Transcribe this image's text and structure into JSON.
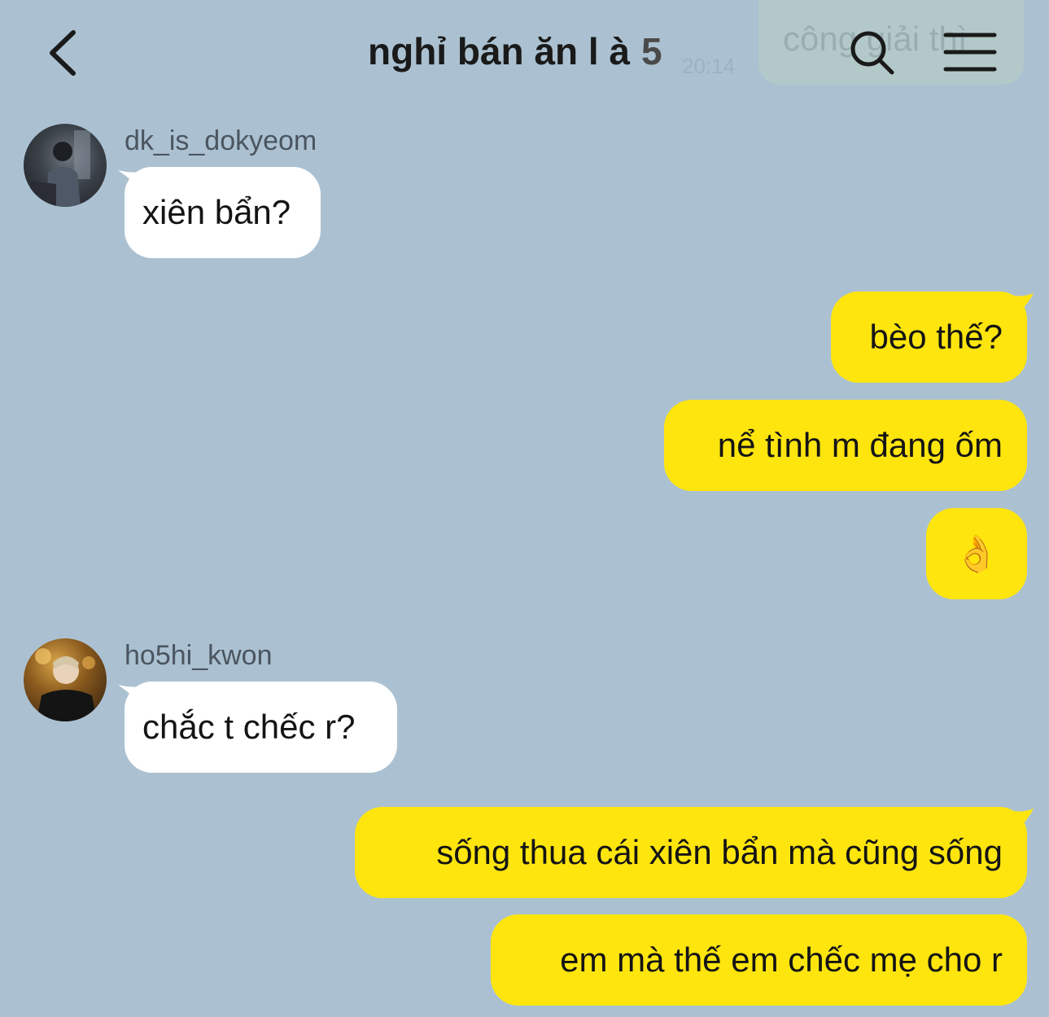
{
  "header": {
    "title": "nghỉ bán ăn l à",
    "member_count": "5",
    "ghost_time": "20:14",
    "ghost_notice": "công giải thì"
  },
  "messages": [
    {
      "direction": "incoming",
      "sender": "dk_is_dokyeom",
      "text": "xiên bẩn?"
    },
    {
      "direction": "outgoing",
      "text": "bèo thế?"
    },
    {
      "direction": "outgoing",
      "text": "nể tình m đang ốm"
    },
    {
      "direction": "outgoing",
      "text": "👌"
    },
    {
      "direction": "incoming",
      "sender": "ho5hi_kwon",
      "text": "chắc t chếc r?"
    },
    {
      "direction": "outgoing",
      "text": "sống thua cái xiên bẩn mà cũng sống"
    },
    {
      "direction": "outgoing",
      "text": "em mà thế em chếc mẹ cho r"
    }
  ],
  "icons": {
    "back": "chevron-left-icon",
    "search": "search-icon",
    "menu": "menu-icon"
  },
  "colors": {
    "background": "#abc1d1",
    "outgoing_bubble": "#ffe50e",
    "incoming_bubble": "#ffffff",
    "text": "#141414"
  }
}
